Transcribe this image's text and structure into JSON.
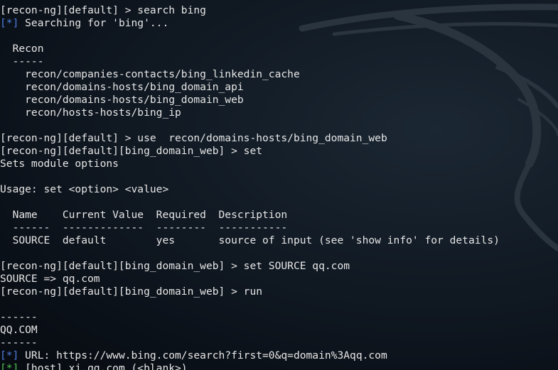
{
  "terminal": {
    "lines": [
      {
        "text": "[recon-ng][default] > search bing"
      },
      {
        "tag": "[*]",
        "tag_color": "#4f7fe0",
        "text": " Searching for 'bing'..."
      },
      {
        "text": ""
      },
      {
        "text": "  Recon"
      },
      {
        "text": "  -----"
      },
      {
        "text": "    recon/companies-contacts/bing_linkedin_cache"
      },
      {
        "text": "    recon/domains-hosts/bing_domain_api"
      },
      {
        "text": "    recon/domains-hosts/bing_domain_web"
      },
      {
        "text": "    recon/hosts-hosts/bing_ip"
      },
      {
        "text": ""
      },
      {
        "text": "[recon-ng][default] > use  recon/domains-hosts/bing_domain_web"
      },
      {
        "text": "[recon-ng][default][bing_domain_web] > set"
      },
      {
        "text": "Sets module options"
      },
      {
        "text": ""
      },
      {
        "text": "Usage: set <option> <value>"
      },
      {
        "text": ""
      },
      {
        "text": "  Name    Current Value  Required  Description"
      },
      {
        "text": "  ------  -------------  --------  -----------"
      },
      {
        "text": "  SOURCE  default        yes       source of input (see 'show info' for details)"
      },
      {
        "text": ""
      },
      {
        "text": "[recon-ng][default][bing_domain_web] > set SOURCE qq.com"
      },
      {
        "text": "SOURCE => qq.com"
      },
      {
        "text": "[recon-ng][default][bing_domain_web] > run"
      },
      {
        "text": ""
      },
      {
        "text": "------"
      },
      {
        "text": "QQ.COM"
      },
      {
        "text": "------"
      },
      {
        "tag": "[*]",
        "tag_color": "#4f7fe0",
        "text": " URL: https://www.bing.com/search?first=0&q=domain%3Aqq.com"
      },
      {
        "tag": "[*]",
        "tag_color": "#4ec24e",
        "text": " [host] xj.qq.com (<blank>)"
      }
    ]
  }
}
